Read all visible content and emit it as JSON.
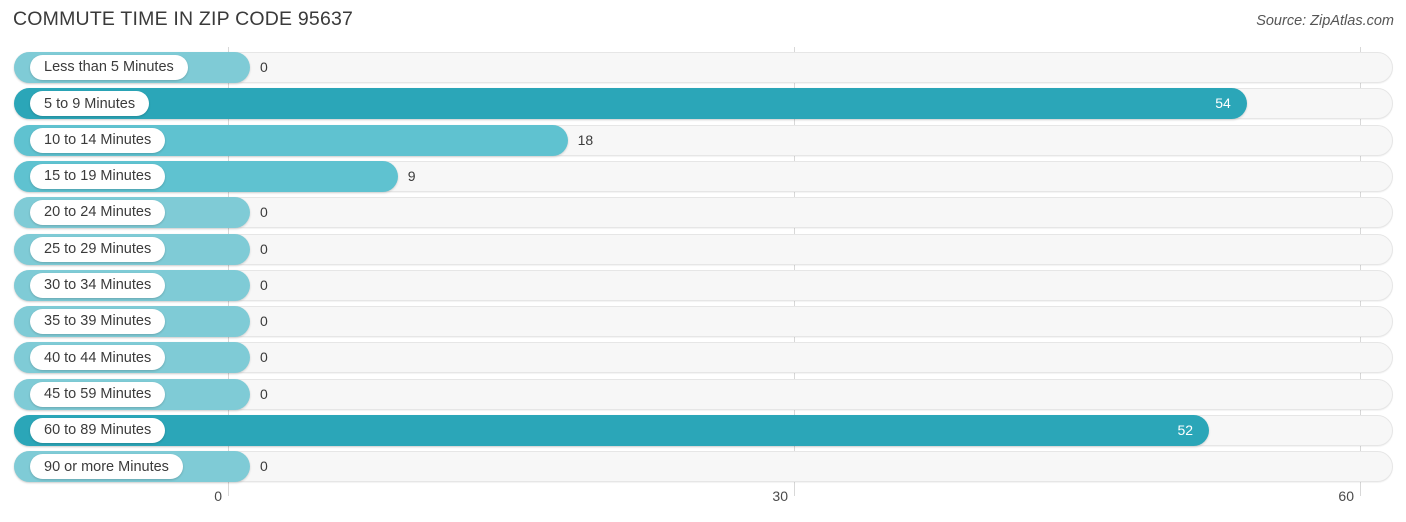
{
  "header": {
    "title": "COMMUTE TIME IN ZIP CODE 95637",
    "source": "Source: ZipAtlas.com"
  },
  "colors": {
    "bar_strong": "#2BA6B8",
    "bar_mid": "#5FC2D0",
    "bar_light": "#7FCBD6",
    "track_fill": "#F7F7F7",
    "track_border": "#E6E6E6",
    "gridline": "#D8D8D8",
    "text": "#3B3B3B",
    "value_inside": "#FFFFFF"
  },
  "chart_data": {
    "type": "bar",
    "orientation": "horizontal",
    "title": "COMMUTE TIME IN ZIP CODE 95637",
    "xlabel": "",
    "ylabel": "",
    "xlim": [
      0,
      60
    ],
    "grid": true,
    "legend": null,
    "xticks": [
      "0",
      "30",
      "60"
    ],
    "xtick_values": [
      0,
      30,
      60
    ],
    "categories": [
      "Less than 5 Minutes",
      "5 to 9 Minutes",
      "10 to 14 Minutes",
      "15 to 19 Minutes",
      "20 to 24 Minutes",
      "25 to 29 Minutes",
      "30 to 34 Minutes",
      "35 to 39 Minutes",
      "40 to 44 Minutes",
      "45 to 59 Minutes",
      "60 to 89 Minutes",
      "90 or more Minutes"
    ],
    "values": [
      0,
      54,
      18,
      9,
      0,
      0,
      0,
      0,
      0,
      0,
      52,
      0
    ],
    "value_labels": [
      "0",
      "54",
      "18",
      "9",
      "0",
      "0",
      "0",
      "0",
      "0",
      "0",
      "52",
      "0"
    ]
  },
  "rows": [
    {
      "label": "Less than 5 Minutes",
      "value": 0,
      "value_label": "0",
      "inside": false
    },
    {
      "label": "5 to 9 Minutes",
      "value": 54,
      "value_label": "54",
      "inside": true
    },
    {
      "label": "10 to 14 Minutes",
      "value": 18,
      "value_label": "18",
      "inside": false
    },
    {
      "label": "15 to 19 Minutes",
      "value": 9,
      "value_label": "9",
      "inside": false
    },
    {
      "label": "20 to 24 Minutes",
      "value": 0,
      "value_label": "0",
      "inside": false
    },
    {
      "label": "25 to 29 Minutes",
      "value": 0,
      "value_label": "0",
      "inside": false
    },
    {
      "label": "30 to 34 Minutes",
      "value": 0,
      "value_label": "0",
      "inside": false
    },
    {
      "label": "35 to 39 Minutes",
      "value": 0,
      "value_label": "0",
      "inside": false
    },
    {
      "label": "40 to 44 Minutes",
      "value": 0,
      "value_label": "0",
      "inside": false
    },
    {
      "label": "45 to 59 Minutes",
      "value": 0,
      "value_label": "0",
      "inside": false
    },
    {
      "label": "60 to 89 Minutes",
      "value": 52,
      "value_label": "52",
      "inside": true
    },
    {
      "label": "90 or more Minutes",
      "value": 0,
      "value_label": "0",
      "inside": false
    }
  ]
}
